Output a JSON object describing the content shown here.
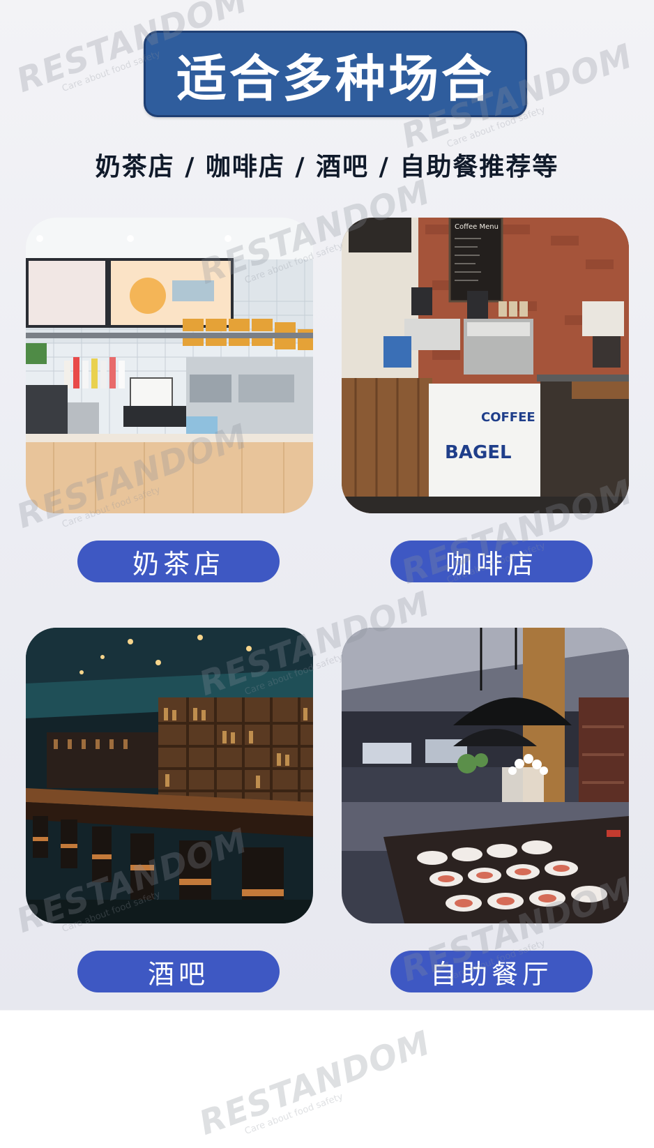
{
  "header": {
    "title": "适合多种场合",
    "subtitle": "奶茶店 /  咖啡店 / 酒吧 / 自助餐推荐等"
  },
  "venues": [
    {
      "label": "奶茶店"
    },
    {
      "label": "咖啡店"
    },
    {
      "label": "酒吧"
    },
    {
      "label": "自助餐厅"
    }
  ],
  "photo_text": {
    "coffee_counter_left": "BAGEL",
    "coffee_counter_right": "COFFEE",
    "coffee_menu": "Coffee Menu"
  },
  "watermark": {
    "brand": "RESTANDOM",
    "tagline": "Care about food safety"
  },
  "colors": {
    "title_bg": "#2f5d9d",
    "pill_bg": "#3e58c3",
    "page_bg": "#ecedf3"
  }
}
